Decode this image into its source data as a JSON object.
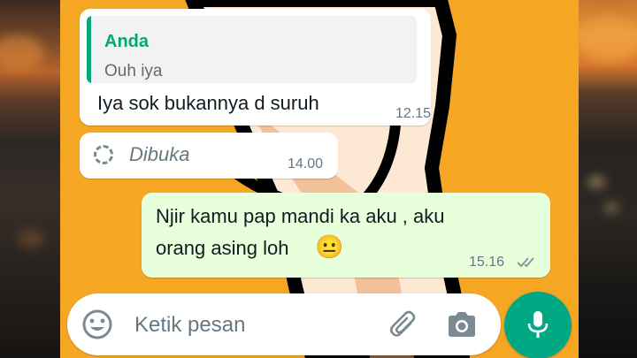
{
  "chat": {
    "background_color": "#f5a623",
    "messages": [
      {
        "direction": "incoming",
        "quoted_author": "Anda",
        "quoted_text": "Ouh iya",
        "text": "Iya sok bukannya d suruh",
        "time": "12.15"
      },
      {
        "direction": "incoming",
        "type": "view-once",
        "text": "Dibuka",
        "time": "14.00"
      },
      {
        "direction": "outgoing",
        "text_line1": "Njir kamu pap mandi ka aku , aku",
        "text_line2": "orang asing loh",
        "emoji": "😐",
        "time": "15.16",
        "status": "read-double-tick"
      }
    ]
  },
  "input_bar": {
    "placeholder": "Ketik pesan",
    "emoji_icon": "emoji-icon",
    "attach_icon": "paperclip-icon",
    "camera_icon": "camera-icon"
  },
  "mic_button": {
    "icon": "microphone-icon",
    "color": "#00a884"
  },
  "colors": {
    "incoming_bubble": "#ffffff",
    "outgoing_bubble": "#e7ffdb",
    "quote_accent": "#06a67b"
  }
}
